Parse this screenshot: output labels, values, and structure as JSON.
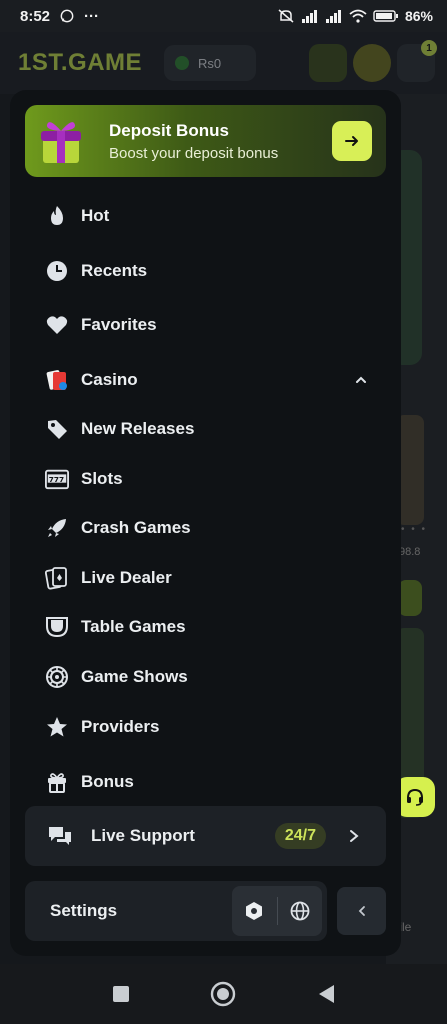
{
  "status_bar": {
    "time": "8:52",
    "more": "···",
    "battery": "86%"
  },
  "app_header": {
    "logo": "1ST.GAME",
    "balance": "Rs0",
    "notification_count": "1"
  },
  "background": {
    "dots": "• • •",
    "value": "98.8",
    "profile": "file"
  },
  "deposit_banner": {
    "title": "Deposit Bonus",
    "subtitle": "Boost your deposit bonus"
  },
  "menu": {
    "items": [
      {
        "label": "Hot",
        "icon": "fire-icon"
      },
      {
        "label": "Recents",
        "icon": "clock-icon"
      },
      {
        "label": "Favorites",
        "icon": "heart-icon"
      },
      {
        "label": "Casino",
        "icon": "cards-icon",
        "expanded": true
      },
      {
        "label": "New Releases",
        "icon": "tag-icon"
      },
      {
        "label": "Slots",
        "icon": "slot-machine-icon"
      },
      {
        "label": "Crash Games",
        "icon": "rocket-icon"
      },
      {
        "label": "Live Dealer",
        "icon": "playing-card-icon"
      },
      {
        "label": "Table Games",
        "icon": "table-icon"
      },
      {
        "label": "Game Shows",
        "icon": "wheel-icon"
      },
      {
        "label": "Providers",
        "icon": "star-icon"
      },
      {
        "label": "Bonus",
        "icon": "gift-icon"
      }
    ]
  },
  "support": {
    "label": "Live Support",
    "hours": "24/7"
  },
  "settings": {
    "label": "Settings"
  },
  "colors": {
    "accent": "#d8ef57",
    "drawer_bg": "#0f1215",
    "row_bg": "#1d2126"
  }
}
